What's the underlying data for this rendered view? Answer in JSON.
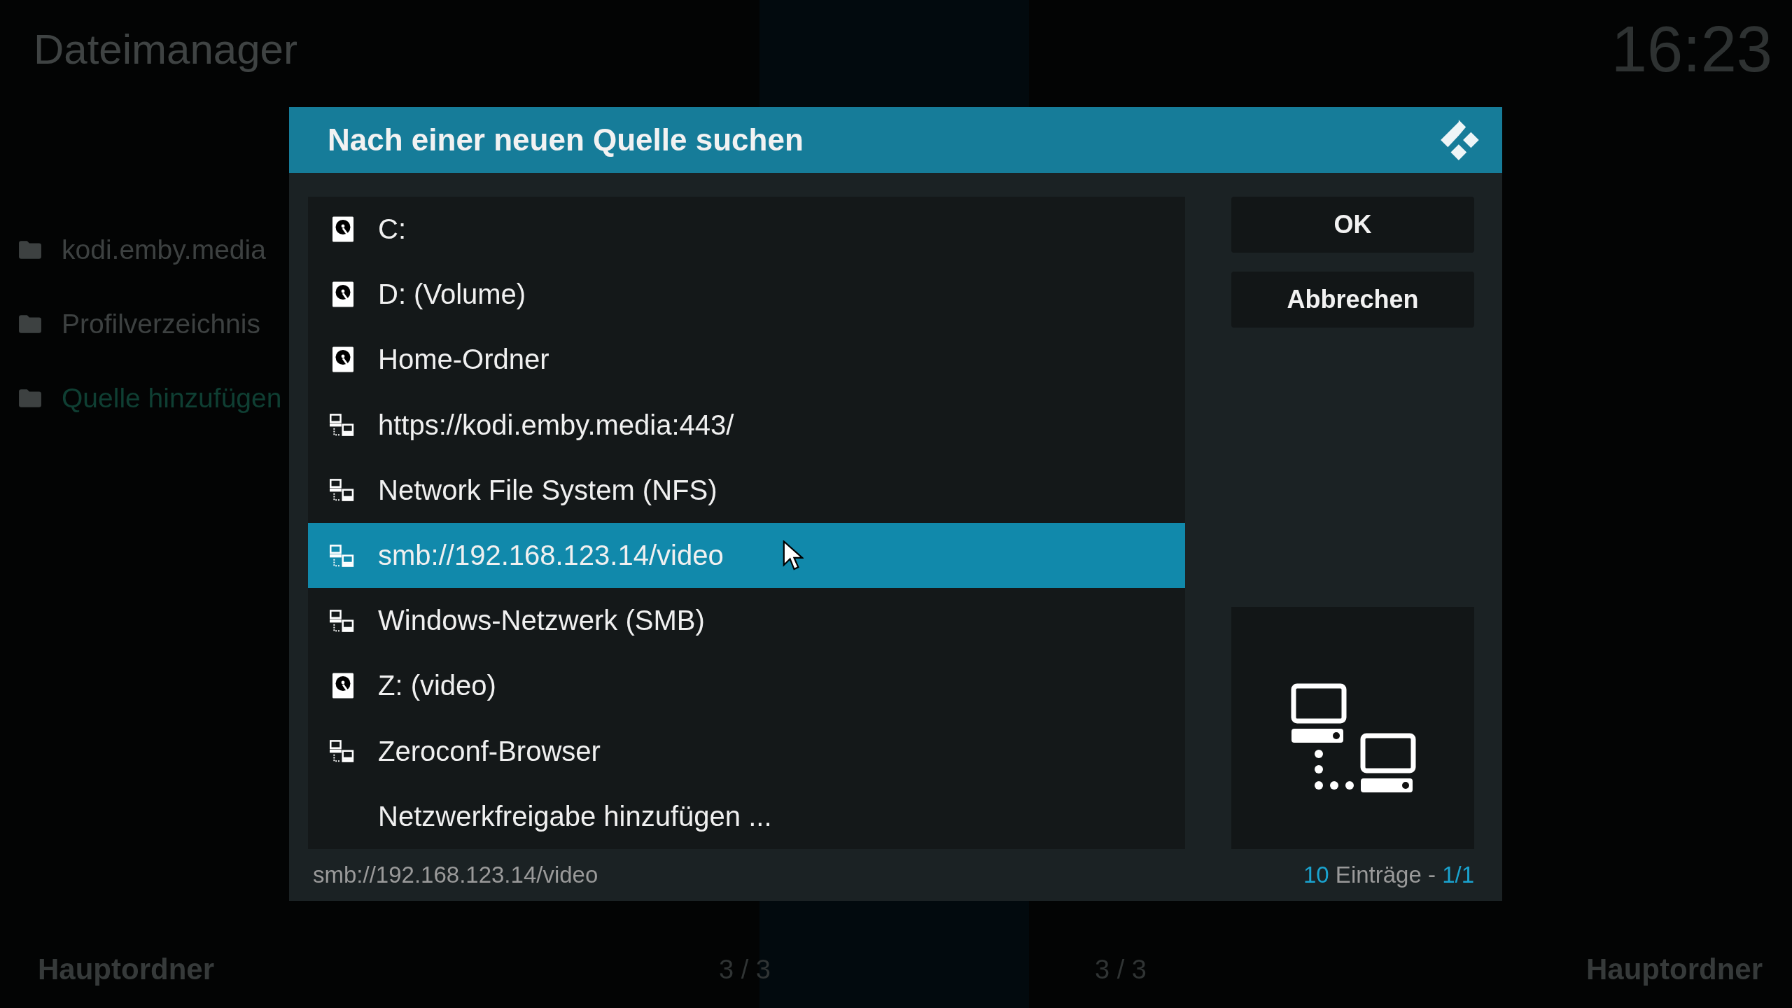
{
  "header": {
    "title": "Dateimanager",
    "clock": "16:23"
  },
  "sidebar": {
    "items": [
      {
        "label": "kodi.emby.media",
        "selected": false
      },
      {
        "label": "Profilverzeichnis",
        "selected": false
      },
      {
        "label": "Quelle hinzufügen",
        "selected": true
      }
    ]
  },
  "bottom_bar": {
    "left": "Hauptordner",
    "page_left": "3 / 3",
    "page_right": "3 / 3",
    "right": "Hauptordner"
  },
  "dialog": {
    "title": "Nach einer neuen Quelle suchen",
    "items": [
      {
        "label": "C:",
        "kind": "drive",
        "selected": false
      },
      {
        "label": "D: (Volume)",
        "kind": "drive",
        "selected": false
      },
      {
        "label": "Home-Ordner",
        "kind": "drive",
        "selected": false
      },
      {
        "label": "https://kodi.emby.media:443/",
        "kind": "network",
        "selected": false
      },
      {
        "label": "Network File System (NFS)",
        "kind": "network",
        "selected": false
      },
      {
        "label": "smb://192.168.123.14/video",
        "kind": "network",
        "selected": true
      },
      {
        "label": "Windows-Netzwerk (SMB)",
        "kind": "network",
        "selected": false
      },
      {
        "label": "Z: (video)",
        "kind": "drive",
        "selected": false
      },
      {
        "label": "Zeroconf-Browser",
        "kind": "network",
        "selected": false
      },
      {
        "label": "Netzwerkfreigabe hinzufügen ...",
        "kind": "plain",
        "selected": false
      }
    ],
    "buttons": [
      "OK",
      "Abbrechen"
    ],
    "footer": {
      "path": "smb://192.168.123.14/video",
      "count": "10",
      "count_label": "Einträge -",
      "page": "1/1"
    }
  }
}
